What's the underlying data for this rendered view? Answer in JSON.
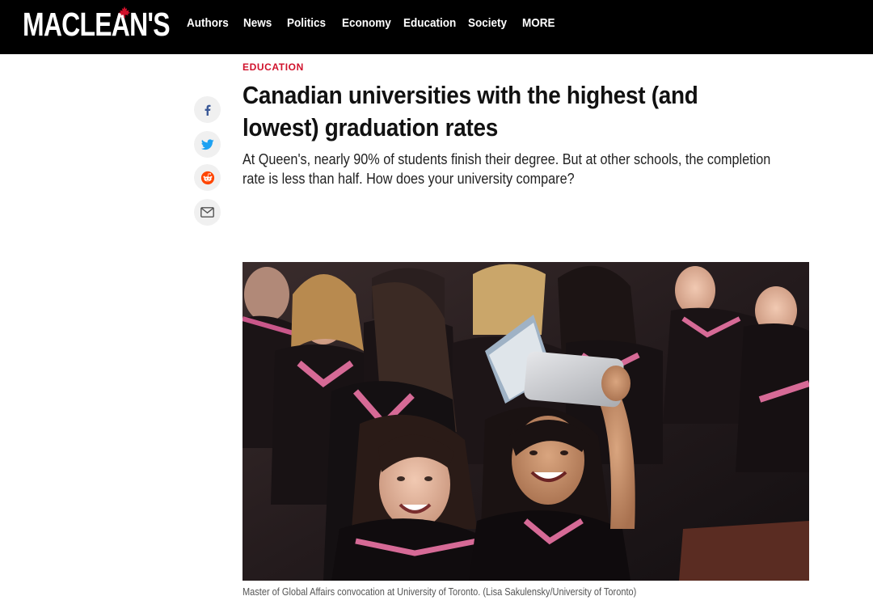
{
  "header": {
    "logo_text": "MACLEAN'S",
    "nav_items": [
      "Authors",
      "News",
      "Politics",
      "Economy",
      "Education",
      "Society",
      "MORE"
    ]
  },
  "share": {
    "icons": [
      "facebook-icon",
      "twitter-icon",
      "reddit-icon",
      "email-icon"
    ]
  },
  "article": {
    "section": "EDUCATION",
    "headline": "Canadian universities with the highest (and lowest) graduation rates",
    "dek": "At Queen's, nearly 90% of students finish their degree. But at other schools, the completion rate is less than half. How does your university compare?",
    "caption": "Master of Global Affairs convocation at University of Toronto. (Lisa Sakulensky/University of Toronto)"
  },
  "colors": {
    "brand_red": "#d0112b",
    "topbar": "#000000",
    "facebook": "#3b5998",
    "twitter": "#1da1f2",
    "reddit": "#ff4500"
  }
}
